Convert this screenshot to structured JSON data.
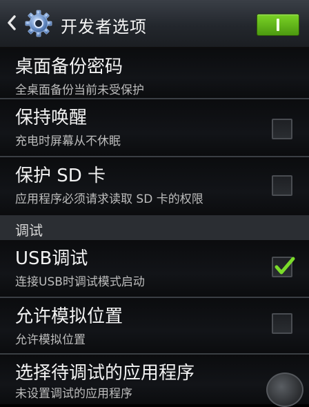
{
  "header": {
    "title": "开发者选项",
    "switch_label": "I",
    "icons": {
      "back": "chevron-left-icon",
      "settings": "gear-icon"
    },
    "accent": "#6cc31f"
  },
  "items": [
    {
      "title": "桌面备份密码",
      "subtitle": "全桌面备份当前未受保护",
      "checkbox": null
    },
    {
      "title": "保持唤醒",
      "subtitle": "充电时屏幕从不休眠",
      "checkbox": false
    },
    {
      "title": "保护 SD 卡",
      "subtitle": "应用程序必须请求读取 SD 卡的权限",
      "checkbox": false
    }
  ],
  "section": {
    "title": "调试"
  },
  "debug_items": [
    {
      "title": "USB调试",
      "subtitle": "连接USB时调试模式启动",
      "checkbox": true
    },
    {
      "title": "允许模拟位置",
      "subtitle": "允许模拟位置",
      "checkbox": false
    },
    {
      "title": "选择待调试的应用程序",
      "subtitle": "未设置调试的应用程序",
      "checkbox": null
    }
  ],
  "colors": {
    "check_green": "#7bdc2a",
    "background": "#000000",
    "section_bg": "#2b2e33"
  }
}
